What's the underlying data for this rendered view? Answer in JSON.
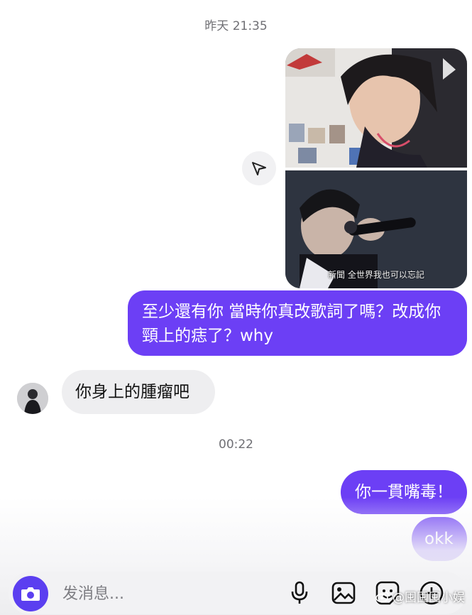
{
  "timestamps": {
    "first": "昨天 21:35",
    "second": "00:22"
  },
  "messages": {
    "outgoing_1": "至少還有你 當時你真改歌詞了嗎？改成你頸上的痣了？why",
    "incoming_1": "你身上的腫瘤吧",
    "outgoing_2": "你一貫嘴毒！",
    "outgoing_3": "okk"
  },
  "shared_post": {
    "subtitle": "新聞 全世界我也可以忘記"
  },
  "composer": {
    "placeholder": "发消息...",
    "icons": [
      "camera-icon",
      "microphone-icon",
      "image-icon",
      "sticker-icon",
      "plus-icon"
    ]
  },
  "watermark": "@囤囤囤小娱",
  "colors": {
    "outgoing_bubble": "#6c3ff5",
    "incoming_bubble": "#eeeef0",
    "camera_button": "#5b3ff0"
  }
}
